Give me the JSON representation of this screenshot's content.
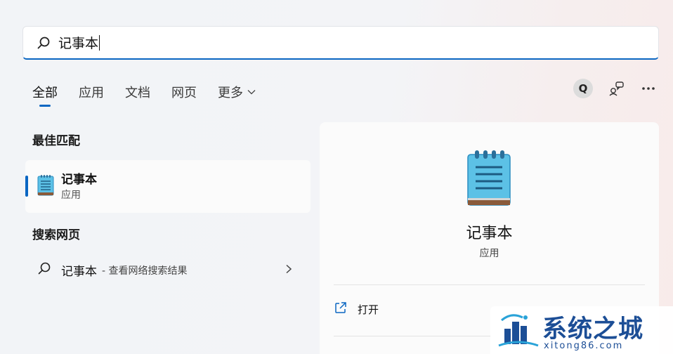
{
  "search": {
    "query": "记事本"
  },
  "tabs": [
    {
      "label": "全部",
      "active": true
    },
    {
      "label": "应用"
    },
    {
      "label": "文档"
    },
    {
      "label": "网页"
    },
    {
      "label": "更多"
    }
  ],
  "toolbar": {
    "avatar_letter": "Q"
  },
  "best_match": {
    "heading": "最佳匹配",
    "item": {
      "title": "记事本",
      "subtitle": "应用"
    }
  },
  "web_search": {
    "heading": "搜索网页",
    "item": {
      "title": "记事本",
      "hint": "- 查看网络搜索结果"
    }
  },
  "details": {
    "app_name": "记事本",
    "app_type": "应用",
    "actions": [
      {
        "label": "打开"
      }
    ]
  },
  "watermark": {
    "brand": "系统之城",
    "url": "xitong86.com"
  },
  "colors": {
    "accent": "#0a66c2",
    "brand": "#1c4e96"
  }
}
